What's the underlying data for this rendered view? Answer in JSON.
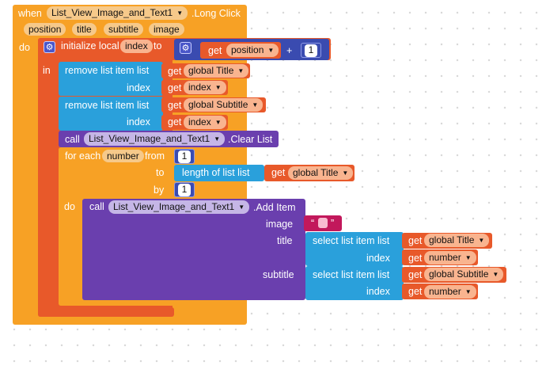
{
  "event": {
    "when": "when",
    "component": "List_View_Image_and_Text1",
    "event_name": ".Long Click",
    "do": "do",
    "params": [
      "position",
      "title",
      "subtitle",
      "image"
    ]
  },
  "init_local": {
    "label": "initialize local",
    "var": "index",
    "to": "to",
    "in": "in",
    "get": "get",
    "position": "position",
    "plus": "+",
    "one": "1"
  },
  "remove1": {
    "label": "remove list item  list",
    "get": "get",
    "list_var": "global Title",
    "index_label": "index",
    "index_var": "index"
  },
  "remove2": {
    "label": "remove list item  list",
    "get": "get",
    "list_var": "global Subtitle",
    "index_label": "index",
    "index_var": "index"
  },
  "clear": {
    "call": "call",
    "component": "List_View_Image_and_Text1",
    "method": ".Clear List"
  },
  "foreach": {
    "label": "for each",
    "var": "number",
    "from": "from",
    "from_val": "1",
    "to": "to",
    "length_label": "length of list  list",
    "get": "get",
    "length_var": "global Title",
    "by": "by",
    "by_val": "1",
    "do": "do"
  },
  "additem": {
    "call": "call",
    "component": "List_View_Image_and_Text1",
    "method": ".Add Item",
    "image": "image",
    "text_open": "“",
    "text_close": "”",
    "title": "title",
    "subtitle": "subtitle",
    "select_label": "select list item  list",
    "index_label": "index",
    "get": "get",
    "title_list": "global Title",
    "subtitle_list": "global Subtitle",
    "index_var": "number"
  },
  "colors": {
    "event": "#f7a125",
    "local": "#e8592a",
    "list": "#2aa0db",
    "math": "#3a4bb0",
    "component": "#6a3fae",
    "text": "#c2185b"
  }
}
